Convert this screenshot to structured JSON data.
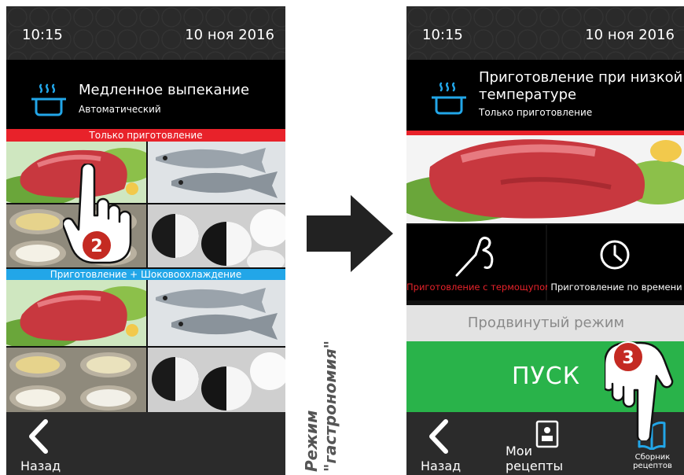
{
  "status": {
    "time": "10:15",
    "date": "10 ноя 2016"
  },
  "left": {
    "mode_title": "Медленное выпекание",
    "mode_sub": "Автоматический",
    "section_cook_only": "Только приготовление",
    "section_cook_chill": "Приготовление + Шоковоохлаждение",
    "step_badge": "2",
    "back_label": "Назад",
    "tiles": [
      "meat-image",
      "fish-image",
      "sauce-image",
      "meringue-image"
    ]
  },
  "right": {
    "mode_title": "Приготовление при низкой температуре",
    "mode_sub": "Только приготовление",
    "probe_label": "Приготовление с термощупом",
    "timer_label": "Приготовление по времени",
    "advanced_label": "Продвинутый режим",
    "start_label": "ПУСК",
    "step_badge": "3",
    "back_label": "Назад",
    "my_recipes_label": "Мои рецепты",
    "recipe_book_label": "Сборник рецептов"
  },
  "caption": {
    "line1": "Режим",
    "line2": "\"гастрономия\""
  },
  "colors": {
    "accent_blue": "#22a6e8",
    "red": "#e8222a",
    "green": "#29b34a",
    "badge": "#c42a22"
  }
}
